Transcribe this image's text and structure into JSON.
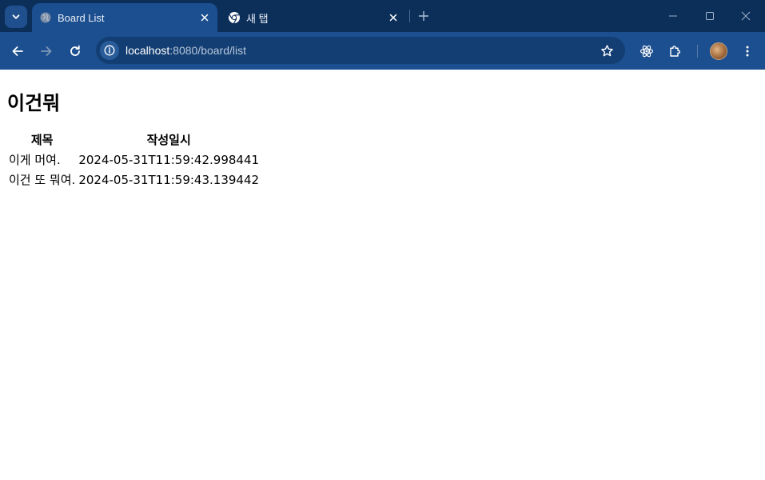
{
  "browser": {
    "tabs": [
      {
        "title": "Board List",
        "active": true
      },
      {
        "title": "새 탭",
        "active": false
      }
    ],
    "url_host": "localhost",
    "url_path": ":8080/board/list",
    "colors": {
      "titlebar": "#0c2f5a",
      "toolbar": "#1c4f8f",
      "omnibox": "#133e73"
    }
  },
  "icons": {
    "tab_search": "chevron-down-icon",
    "active_favicon": "globe-icon",
    "inactive_favicon": "chrome-icon",
    "close": "close-icon",
    "new_tab": "plus-icon",
    "back": "arrow-left-icon",
    "forward": "arrow-right-icon",
    "reload": "reload-icon",
    "site_info": "info-icon",
    "bookmark": "star-icon",
    "extension_react": "react-icon",
    "extensions": "puzzle-icon",
    "profile": "avatar",
    "menu": "kebab-menu-icon"
  },
  "page": {
    "title": "이건뭐",
    "table": {
      "headers": [
        "제목",
        "작성일시"
      ],
      "rows": [
        [
          "이게 머여.",
          "2024-05-31T11:59:42.998441"
        ],
        [
          "이건 또 뭐여.",
          "2024-05-31T11:59:43.139442"
        ]
      ]
    }
  }
}
